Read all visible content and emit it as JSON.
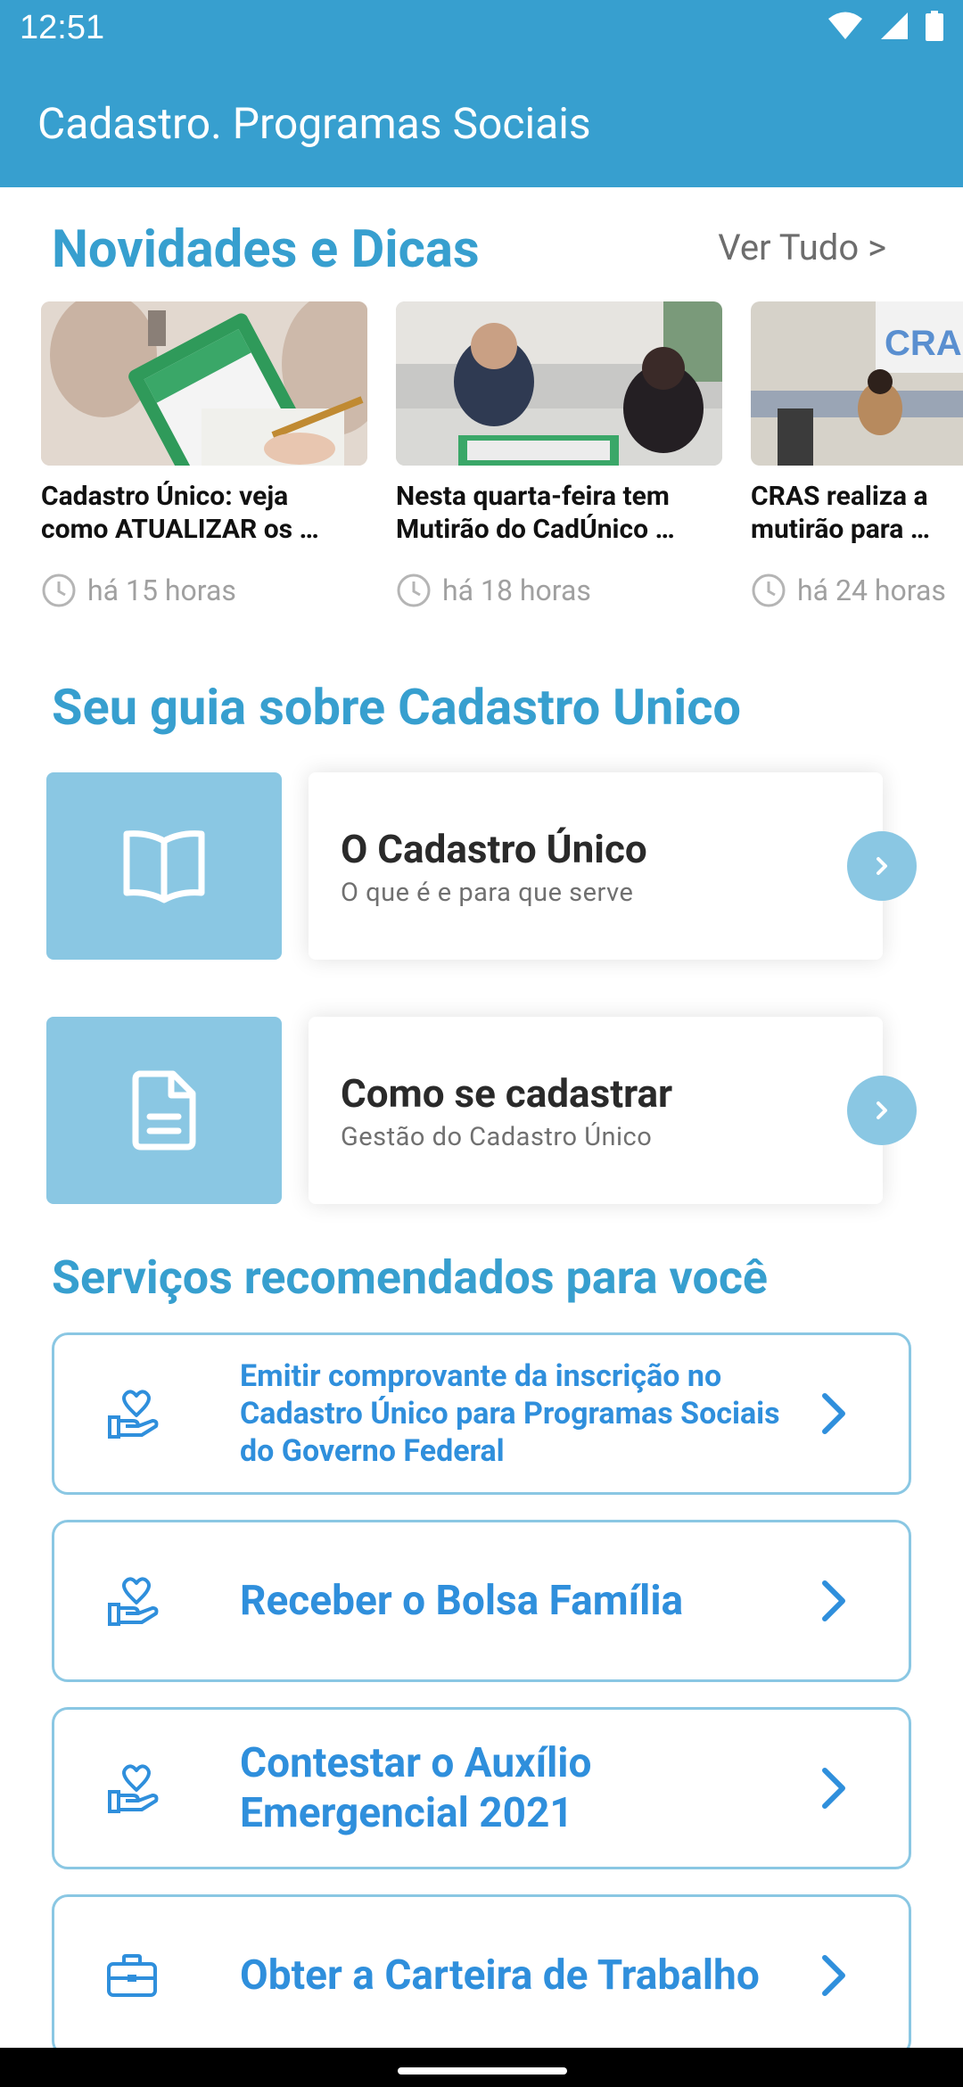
{
  "status": {
    "time": "12:51"
  },
  "app": {
    "title": "Cadastro. Programas Sociais",
    "accent": "#379fcf"
  },
  "news": {
    "title": "Novidades e Dicas",
    "see_all": "Ver Tudo >",
    "items": [
      {
        "line1": "Cadastro Único: veja",
        "line2": "como ATUALIZAR os …",
        "time": "há 15 horas"
      },
      {
        "line1": "Nesta quarta-feira tem",
        "line2": "Mutirão do CadÚnico …",
        "time": "há 18 horas"
      },
      {
        "line1": "CRAS realiza a",
        "line2": "mutirão para …",
        "time": "há 24 horas"
      }
    ]
  },
  "guide": {
    "title": "Seu guia sobre Cadastro Unico",
    "items": [
      {
        "title": "O Cadastro Único",
        "subtitle": "O que é e para que serve",
        "icon": "book-icon"
      },
      {
        "title": "Como se cadastrar",
        "subtitle": "Gestão do Cadastro Único",
        "icon": "document-icon"
      }
    ]
  },
  "services": {
    "title": "Serviços recomendados para você",
    "items": [
      {
        "label": "Emitir comprovante da inscrição no Cadastro Único para Programas Sociais do Governo Federal",
        "icon": "hand-heart-icon"
      },
      {
        "label": "Receber o Bolsa Família",
        "icon": "hand-heart-icon"
      },
      {
        "label": "Contestar o Auxílio Emergencial 2021",
        "icon": "hand-heart-icon"
      },
      {
        "label": "Obter a Carteira de Trabalho",
        "icon": "briefcase-icon"
      }
    ]
  }
}
